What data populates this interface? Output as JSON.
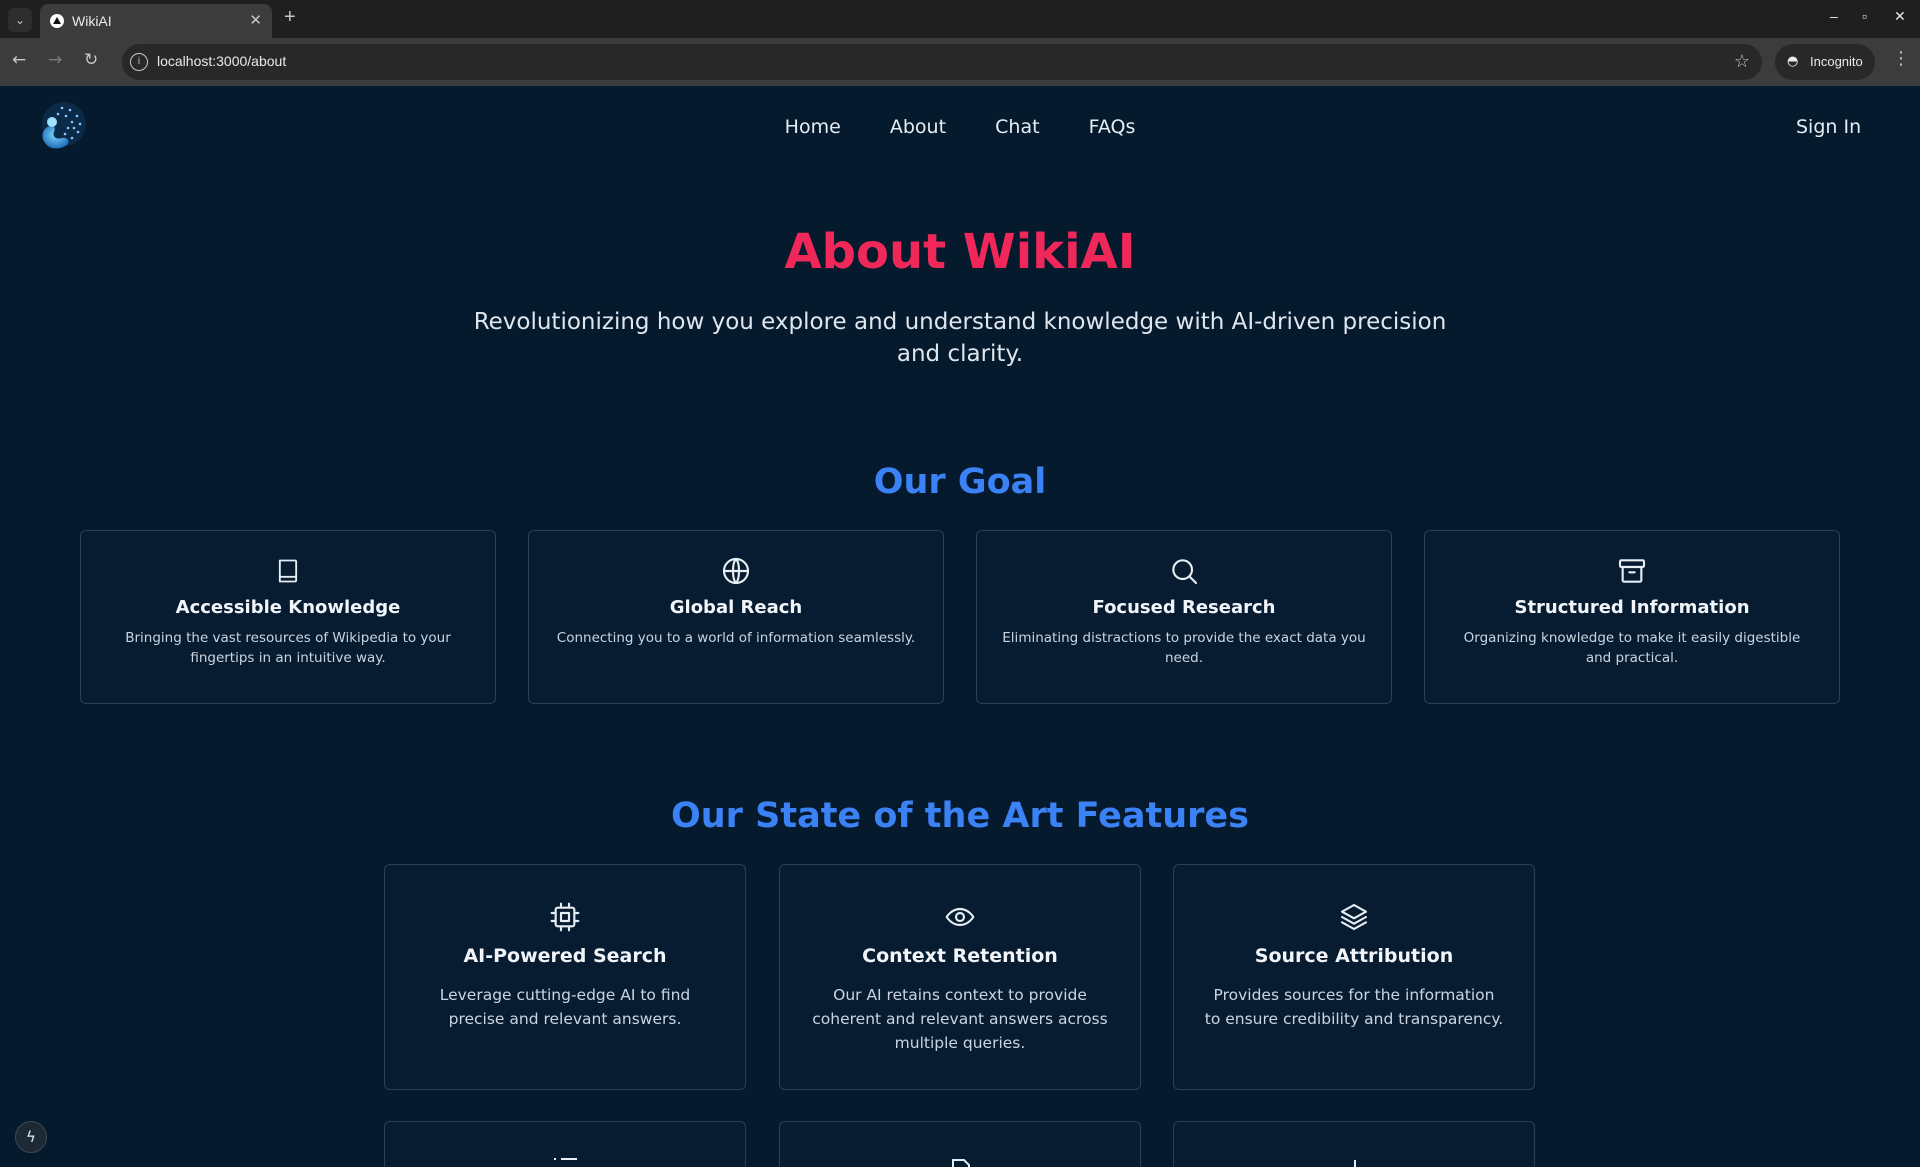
{
  "browser": {
    "tab_title": "WikiAI",
    "tab_close": "✕",
    "new_tab": "+",
    "url": "localhost:3000/about",
    "incognito_label": "Incognito",
    "window_minimize": "–",
    "window_restore": "▫",
    "window_close": "✕"
  },
  "nav": {
    "items": [
      {
        "label": "Home"
      },
      {
        "label": "About"
      },
      {
        "label": "Chat"
      },
      {
        "label": "FAQs"
      }
    ],
    "signin": "Sign In"
  },
  "hero": {
    "title": "About WikiAI",
    "subtitle": "Revolutionizing how you explore and understand knowledge with AI-driven precision and clarity."
  },
  "goal": {
    "title": "Our Goal",
    "cards": [
      {
        "icon": "book-icon",
        "title": "Accessible Knowledge",
        "desc": "Bringing the vast resources of Wikipedia to your fingertips in an intuitive way."
      },
      {
        "icon": "globe-icon",
        "title": "Global Reach",
        "desc": "Connecting you to a world of information seamlessly."
      },
      {
        "icon": "search-icon",
        "title": "Focused Research",
        "desc": "Eliminating distractions to provide the exact data you need."
      },
      {
        "icon": "archive-icon",
        "title": "Structured Information",
        "desc": "Organizing knowledge to make it easily digestible and practical."
      }
    ]
  },
  "features": {
    "title": "Our State of the Art Features",
    "cards": [
      {
        "icon": "cpu-icon",
        "title": "AI-Powered Search",
        "desc": "Leverage cutting-edge AI to find precise and relevant answers."
      },
      {
        "icon": "eye-icon",
        "title": "Context Retention",
        "desc": "Our AI retains context to provide coherent and relevant answers across multiple queries."
      },
      {
        "icon": "layers-icon",
        "title": "Source Attribution",
        "desc": "Provides sources for the information to ensure credibility and transparency."
      }
    ],
    "partial_icons": [
      "list-icon",
      "file-icon",
      "plus-icon"
    ]
  },
  "colors": {
    "background": "#061a2e",
    "hero_title": "#f0285a",
    "section_title": "#3b82f6",
    "card_border": "#2c3f54"
  }
}
